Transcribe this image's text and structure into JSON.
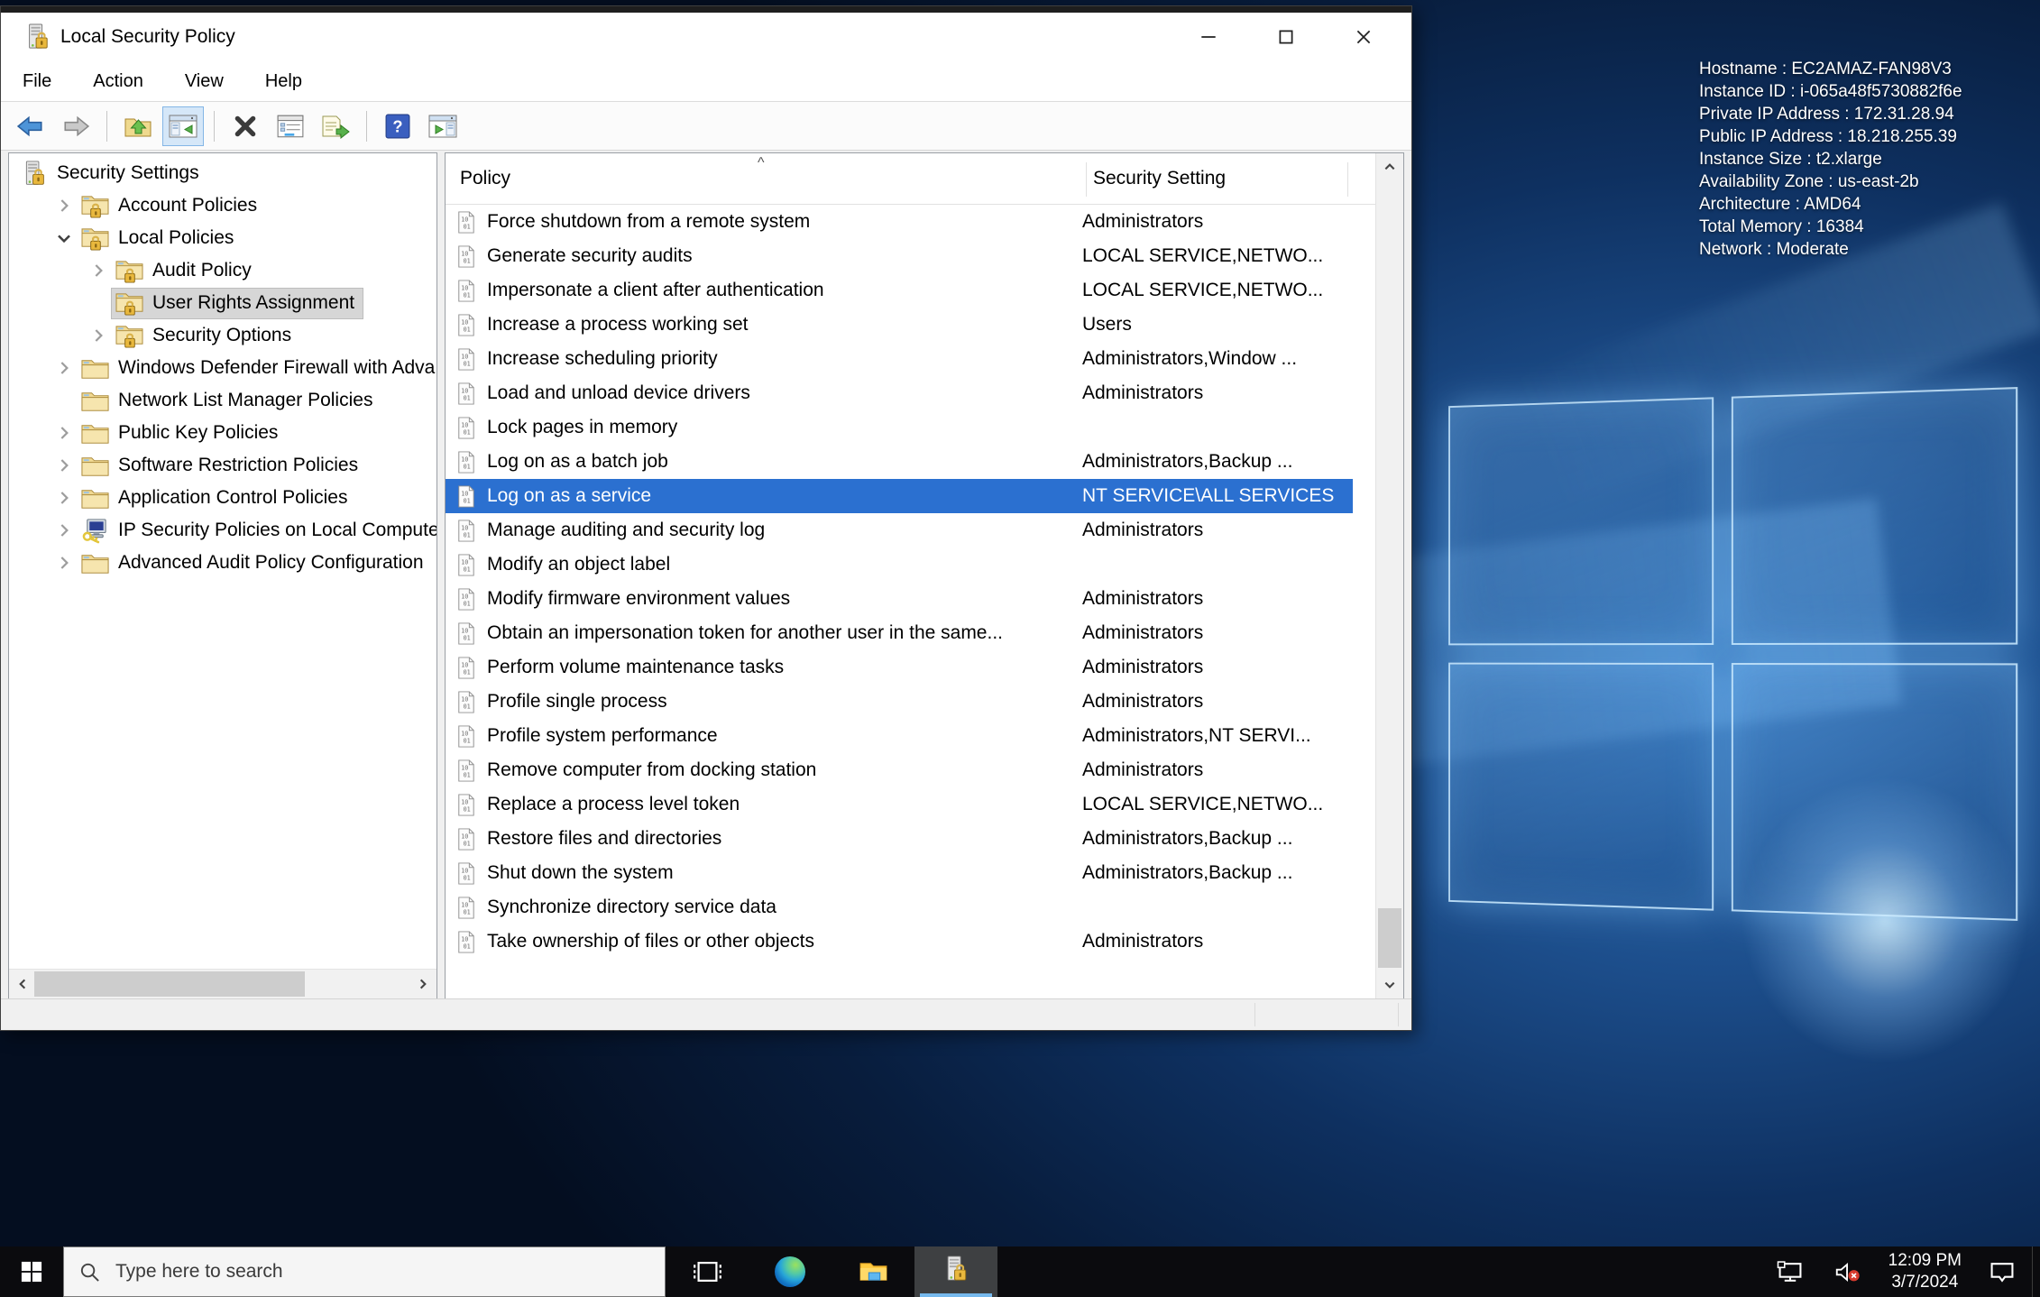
{
  "window": {
    "title": "Local Security Policy",
    "menu": [
      "File",
      "Action",
      "View",
      "Help"
    ],
    "toolbar_buttons": [
      "back",
      "forward",
      "separator",
      "up-one-level",
      "show-console-tree",
      "separator",
      "delete",
      "properties",
      "export-list",
      "separator",
      "help",
      "show-action-pane"
    ]
  },
  "tree": {
    "items": [
      {
        "label": "Security Settings",
        "level": 0,
        "icon": "server-lock",
        "expand": null,
        "selected": false
      },
      {
        "label": "Account Policies",
        "level": 1,
        "icon": "folder-lock",
        "expand": "collapsed",
        "selected": false
      },
      {
        "label": "Local Policies",
        "level": 1,
        "icon": "folder-lock",
        "expand": "expanded",
        "selected": false
      },
      {
        "label": "Audit Policy",
        "level": 2,
        "icon": "folder-lock",
        "expand": "collapsed",
        "selected": false
      },
      {
        "label": "User Rights Assignment",
        "level": 2,
        "icon": "folder-lock",
        "expand": null,
        "selected": true
      },
      {
        "label": "Security Options",
        "level": 2,
        "icon": "folder-lock",
        "expand": "collapsed",
        "selected": false
      },
      {
        "label": "Windows Defender Firewall with Adva",
        "level": 1,
        "icon": "folder",
        "expand": "collapsed",
        "selected": false
      },
      {
        "label": "Network List Manager Policies",
        "level": 1,
        "icon": "folder",
        "expand": null,
        "selected": false
      },
      {
        "label": "Public Key Policies",
        "level": 1,
        "icon": "folder",
        "expand": "collapsed",
        "selected": false
      },
      {
        "label": "Software Restriction Policies",
        "level": 1,
        "icon": "folder",
        "expand": "collapsed",
        "selected": false
      },
      {
        "label": "Application Control Policies",
        "level": 1,
        "icon": "folder",
        "expand": "collapsed",
        "selected": false
      },
      {
        "label": "IP Security Policies on Local Compute",
        "level": 1,
        "icon": "ipsec",
        "expand": "collapsed",
        "selected": false
      },
      {
        "label": "Advanced Audit Policy Configuration",
        "level": 1,
        "icon": "folder",
        "expand": "collapsed",
        "selected": false
      }
    ]
  },
  "list": {
    "columns": [
      "Policy",
      "Security Setting"
    ],
    "sort_indicator": "^",
    "rows": [
      {
        "policy": "Force shutdown from a remote system",
        "setting": "Administrators",
        "selected": false
      },
      {
        "policy": "Generate security audits",
        "setting": "LOCAL SERVICE,NETWO...",
        "selected": false
      },
      {
        "policy": "Impersonate a client after authentication",
        "setting": "LOCAL SERVICE,NETWO...",
        "selected": false
      },
      {
        "policy": "Increase a process working set",
        "setting": "Users",
        "selected": false
      },
      {
        "policy": "Increase scheduling priority",
        "setting": "Administrators,Window ...",
        "selected": false
      },
      {
        "policy": "Load and unload device drivers",
        "setting": "Administrators",
        "selected": false
      },
      {
        "policy": "Lock pages in memory",
        "setting": "",
        "selected": false
      },
      {
        "policy": "Log on as a batch job",
        "setting": "Administrators,Backup ...",
        "selected": false
      },
      {
        "policy": "Log on as a service",
        "setting": "NT SERVICE\\ALL SERVICES",
        "selected": true
      },
      {
        "policy": "Manage auditing and security log",
        "setting": "Administrators",
        "selected": false
      },
      {
        "policy": "Modify an object label",
        "setting": "",
        "selected": false
      },
      {
        "policy": "Modify firmware environment values",
        "setting": "Administrators",
        "selected": false
      },
      {
        "policy": "Obtain an impersonation token for another user in the same...",
        "setting": "Administrators",
        "selected": false
      },
      {
        "policy": "Perform volume maintenance tasks",
        "setting": "Administrators",
        "selected": false
      },
      {
        "policy": "Profile single process",
        "setting": "Administrators",
        "selected": false
      },
      {
        "policy": "Profile system performance",
        "setting": "Administrators,NT SERVI...",
        "selected": false
      },
      {
        "policy": "Remove computer from docking station",
        "setting": "Administrators",
        "selected": false
      },
      {
        "policy": "Replace a process level token",
        "setting": "LOCAL SERVICE,NETWO...",
        "selected": false
      },
      {
        "policy": "Restore files and directories",
        "setting": "Administrators,Backup ...",
        "selected": false
      },
      {
        "policy": "Shut down the system",
        "setting": "Administrators,Backup ...",
        "selected": false
      },
      {
        "policy": "Synchronize directory service data",
        "setting": "",
        "selected": false
      },
      {
        "policy": "Take ownership of files or other objects",
        "setting": "Administrators",
        "selected": false
      }
    ]
  },
  "desktop": {
    "info_lines": [
      "Hostname : EC2AMAZ-FAN98V3",
      "Instance ID : i-065a48f5730882f6e",
      "Private IP Address : 172.31.28.94",
      "Public IP Address : 18.218.255.39",
      "Instance Size : t2.xlarge",
      "Availability Zone : us-east-2b",
      "Architecture : AMD64",
      "Total Memory : 16384",
      "Network : Moderate"
    ]
  },
  "taskbar": {
    "search_placeholder": "Type here to search",
    "clock": {
      "time": "12:09 PM",
      "date": "3/7/2024"
    }
  },
  "colors": {
    "selection_blue": "#2b70d0",
    "tree_selection_gray": "#d6d6d6",
    "taskbar_accent": "#76b9ed"
  }
}
